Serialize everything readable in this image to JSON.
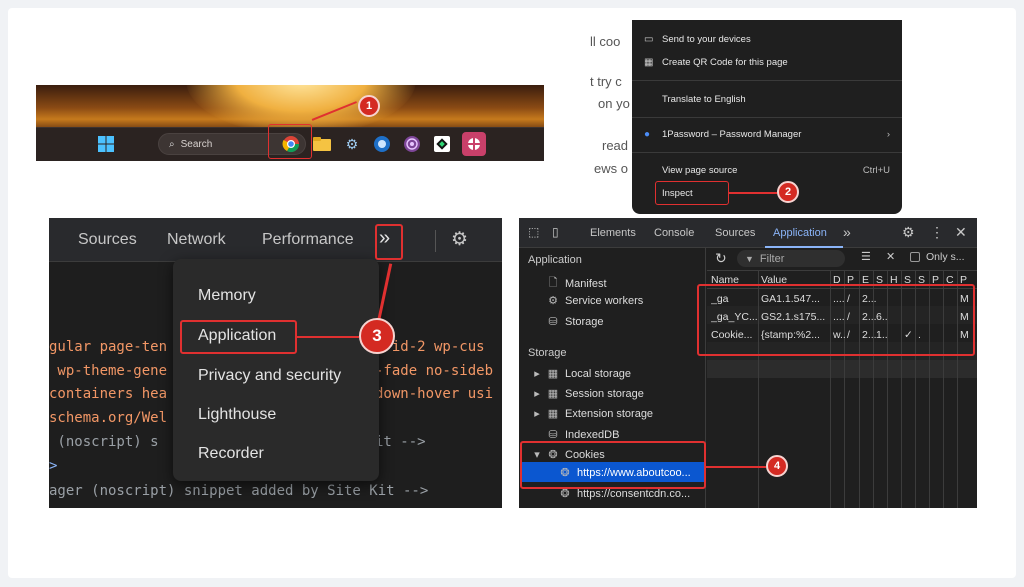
{
  "panel_taskbar": {
    "search_label": "Search",
    "badge": "1"
  },
  "panel_context_menu": {
    "bg_text": [
      "ll coo",
      "t try c",
      "on yo",
      "read",
      "ews o"
    ],
    "items": {
      "send": "Send to your devices",
      "qr": "Create QR Code for this page",
      "translate": "Translate to English",
      "onepassword": "1Password – Password Manager",
      "view_source": "View page source",
      "view_source_shortcut": "Ctrl+U",
      "inspect": "Inspect"
    },
    "badge": "2"
  },
  "panel_devtools_tabs": {
    "tabs": [
      "Sources",
      "Network",
      "Performance"
    ],
    "overflow": "»",
    "code_lines": [
      "gular page-ten",
      " wp-theme-gene",
      "containers hea",
      "schema.org/Wel",
      " (noscript) s",
      ">",
      "ager (noscript) snippet added by Site Kit -->"
    ],
    "code_right": [
      "e-id-2 wp-cus",
      "-fade no-sideb",
      "down-hover usi",
      "it -->"
    ],
    "menu": [
      "Memory",
      "Application",
      "Privacy and security",
      "Lighthouse",
      "Recorder"
    ],
    "badge": "3"
  },
  "panel_application": {
    "tabs": [
      "Elements",
      "Console",
      "Sources",
      "Application"
    ],
    "overflow": "»",
    "filter_placeholder": "Filter",
    "only_label": "Only s...",
    "sidebar": {
      "app_header": "Application",
      "app_items": [
        "Manifest",
        "Service workers",
        "Storage"
      ],
      "storage_header": "Storage",
      "storage_items": [
        "Local storage",
        "Session storage",
        "Extension storage",
        "IndexedDB",
        "Cookies"
      ],
      "cookie_sites": [
        "https://www.aboutcoo...",
        "https://consentcdn.co..."
      ]
    },
    "columns": [
      "Name",
      "Value",
      "D",
      "P",
      "E",
      "S",
      "H",
      "S",
      "S",
      "P",
      "C",
      "P"
    ],
    "rows": [
      [
        "_ga",
        "GA1.1.547...",
        "....",
        "/",
        "2...",
        "",
        "",
        "",
        "",
        "",
        "",
        "M"
      ],
      [
        "_ga_YC...",
        "GS2.1.s175...",
        "....",
        "/",
        "2...",
        "6..",
        "",
        "",
        "",
        "",
        "",
        "M"
      ],
      [
        "Cookie...",
        "{stamp:%2...",
        "w..",
        "/",
        "2...",
        "1..",
        "",
        "✓",
        ".",
        "",
        "",
        "M"
      ]
    ],
    "badge": "4"
  },
  "colors": {
    "accent_red": "#e03030",
    "devtools_bg": "#1f1f1f",
    "active_tab": "#8ab4f8"
  }
}
